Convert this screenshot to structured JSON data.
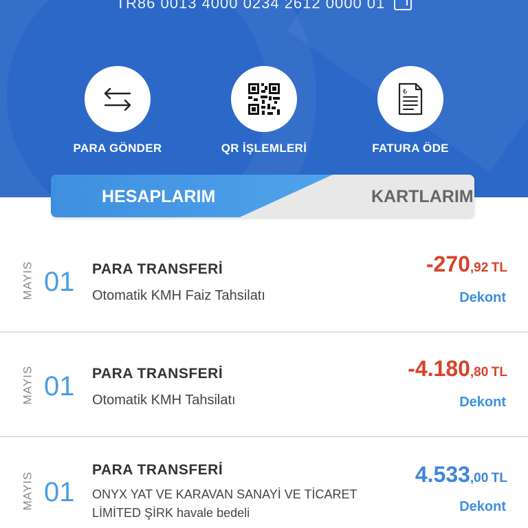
{
  "account": {
    "iban": "TR86 0013 4000 0234 2612 0000 01"
  },
  "actions": [
    {
      "label": "PARA GÖNDER",
      "icon": "transfer-arrows-icon"
    },
    {
      "label": "QR İŞLEMLERİ",
      "icon": "qr-code-icon"
    },
    {
      "label": "FATURA ÖDE",
      "icon": "invoice-icon"
    }
  ],
  "tabs": {
    "accounts": "HESAPLARIM",
    "cards": "KARTLARIM",
    "active": "HESAPLARIM"
  },
  "transactions": [
    {
      "month": "MAYIS",
      "day": "01",
      "type": "PARA TRANSFERİ",
      "description": "Otomatik KMH Faiz Tahsilatı",
      "amount_main": "-270",
      "amount_decimal": ",92",
      "currency": "TL",
      "receipt_label": "Dekont"
    },
    {
      "month": "MAYIS",
      "day": "01",
      "type": "PARA TRANSFERİ",
      "description": "Otomatik KMH Tahsilatı",
      "amount_main": "-4.180",
      "amount_decimal": ",80",
      "currency": "TL",
      "receipt_label": "Dekont"
    },
    {
      "month": "MAYIS",
      "day": "01",
      "type": "PARA TRANSFERİ",
      "description": "ONYX YAT VE KARAVAN SANAYİ VE TİCARET LİMİTED ŞİRK  havale bedeli",
      "amount_main": "4.533",
      "amount_decimal": ",00",
      "currency": "TL",
      "receipt_label": "Dekont"
    }
  ],
  "colors": {
    "header": "#2b68c8",
    "negative": "#d9412b",
    "positive": "#3d86d9",
    "accent": "#4a9de2"
  }
}
